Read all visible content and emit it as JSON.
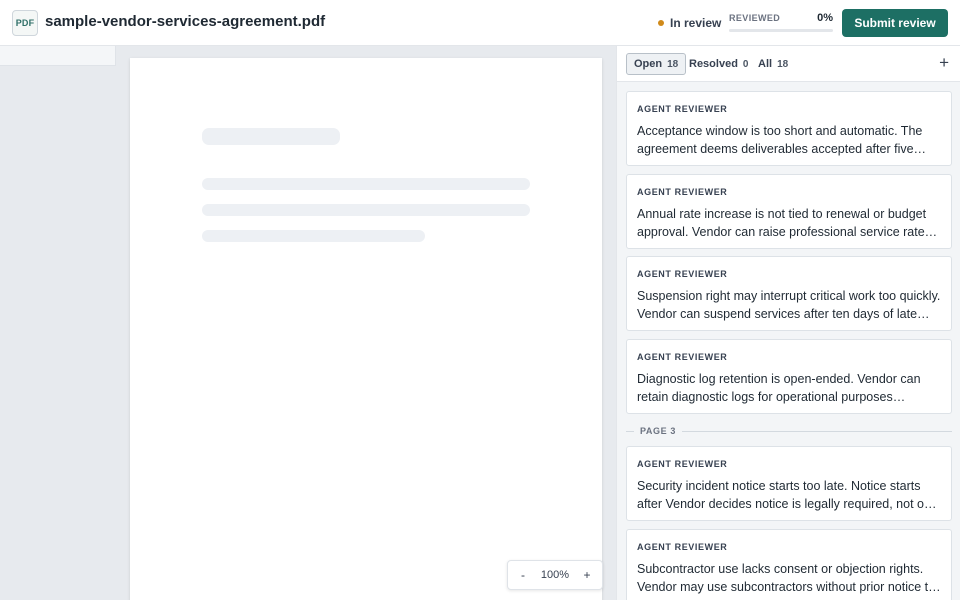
{
  "header": {
    "file_badge": "PDF",
    "file_name": "sample-vendor-services-agreement.pdf",
    "status": "In review",
    "status_color": "#d08a1a",
    "reviewed_label": "REVIEWED",
    "reviewed_percent": "0%",
    "reviewed_progress": 0,
    "submit_label": "Submit review"
  },
  "viewer": {
    "zoom_out": "-",
    "zoom_level": "100%",
    "zoom_in": "+"
  },
  "panel": {
    "tabs": [
      {
        "label": "Open",
        "count": "18"
      },
      {
        "label": "Resolved",
        "count": "0"
      },
      {
        "label": "All",
        "count": "18"
      }
    ],
    "add_icon": "plus-icon",
    "page_separator": "PAGE 3",
    "comments": [
      {
        "author": "AGENT REVIEWER",
        "text": "Acceptance window is too short and automatic. The agreement deems deliverables accepted after five business days without written rejection."
      },
      {
        "author": "AGENT REVIEWER",
        "text": "Annual rate increase is not tied to renewal or budget approval. Vendor can raise professional service rates each year."
      },
      {
        "author": "AGENT REVIEWER",
        "text": "Suspension right may interrupt critical work too quickly. Vendor can suspend services after ten days of late payment."
      },
      {
        "author": "AGENT REVIEWER",
        "text": "Diagnostic log retention is open-ended. Vendor can retain diagnostic logs for operational purposes indefinitely."
      },
      {
        "author": "AGENT REVIEWER",
        "text": "Security incident notice starts too late. Notice starts after Vendor decides notice is legally required, not on discovery."
      },
      {
        "author": "AGENT REVIEWER",
        "text": "Subcontractor use lacks consent or objection rights. Vendor may use subcontractors without prior notice to customer."
      }
    ]
  },
  "colors": {
    "accent": "#1d6f64",
    "viewer_bg": "#e7eaee",
    "panel_bg": "#f3f5f7"
  }
}
